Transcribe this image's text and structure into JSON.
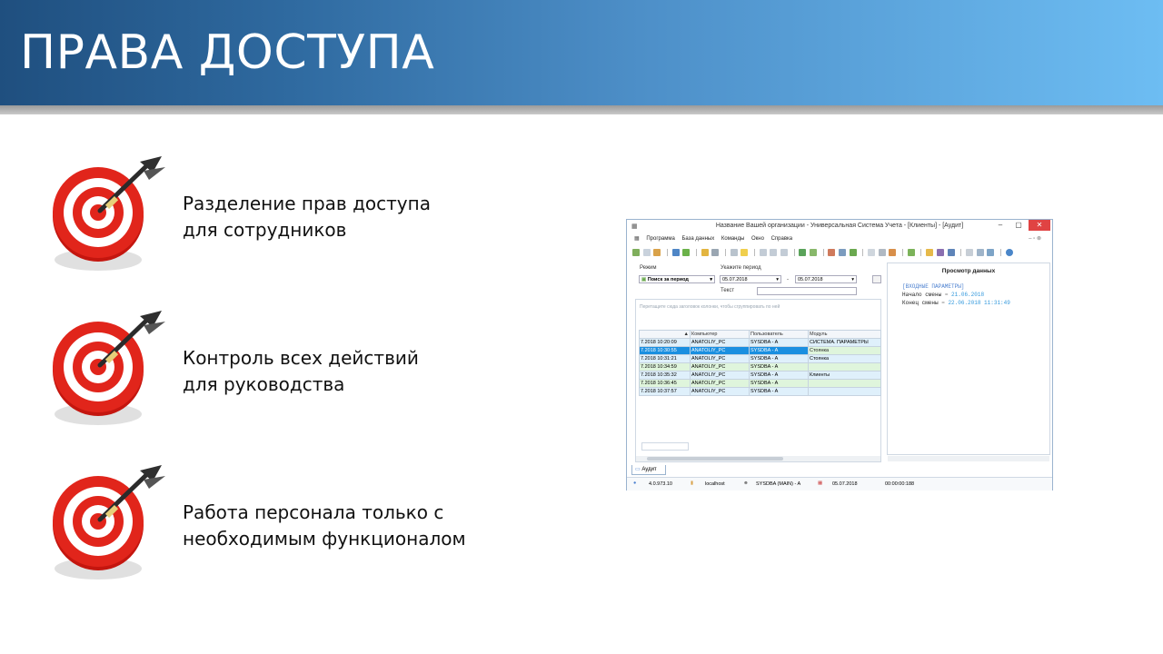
{
  "slide": {
    "title": "ПРАВА ДОСТУПА",
    "bullets": [
      {
        "line1": "Разделение прав доступа",
        "line2": "для сотрудников"
      },
      {
        "line1": "Контроль всех действий",
        "line2": "для руководства"
      },
      {
        "line1": "Работа персонала только с",
        "line2": "необходимым функционалом"
      }
    ]
  },
  "app": {
    "window_title": "Название Вашей организации - Универсальная Система Учета - [Клиенты] - [Аудит]",
    "menu": [
      "Программа",
      "База данных",
      "Команды",
      "Окно",
      "Справка"
    ],
    "filter": {
      "mode_label": "Режим",
      "mode_value": "Поиск за период",
      "period_label": "Укажите период",
      "date_from": "05.07.2018",
      "date_to": "05.07.2018",
      "dash": "-",
      "text_label": "Текст"
    },
    "group_hint": "Перетащите сюда заголовок колонки, чтобы сгруппировать по ней",
    "columns": [
      "",
      "Компьютер",
      "Пользователь",
      "Модуль"
    ],
    "rows": [
      {
        "time": "7.2018 10:20:09",
        "computer": "ANATOLIY_PC",
        "user": "SYSDBA - A",
        "module": "СИСТЕМА. ПАРАМЕТРЫ"
      },
      {
        "time": "7.2018 10:30:55",
        "computer": "ANATOLIY_PC",
        "user": "SYSDBA - A",
        "module": "Стоянка"
      },
      {
        "time": "7.2018 10:31:21",
        "computer": "ANATOLIY_PC",
        "user": "SYSDBA - A",
        "module": "Стоянка"
      },
      {
        "time": "7.2018 10:34:59",
        "computer": "ANATOLIY_PC",
        "user": "SYSDBA - A",
        "module": ""
      },
      {
        "time": "7.2018 10:35:32",
        "computer": "ANATOLIY_PC",
        "user": "SYSDBA - A",
        "module": "Клиенты"
      },
      {
        "time": "7.2018 10:36:45",
        "computer": "ANATOLIY_PC",
        "user": "SYSDBA - A",
        "module": ""
      },
      {
        "time": "7.2018 10:37:57",
        "computer": "ANATOLIY_PC",
        "user": "SYSDBA - A",
        "module": ""
      }
    ],
    "preview": {
      "title": "Просмотр данных",
      "line1": "[ВХОДНЫЕ ПАРАМЕТРЫ]",
      "line2_key": "Начало смены",
      "line2_val": "21.06.2018",
      "line3_key": "Конец смены",
      "line3_val": "22.06.2018 11:31:49",
      "eq": "="
    },
    "tab": "Аудит",
    "status": {
      "version": "4.0.973.10",
      "host": "localhost",
      "user": "SYSDBA (MAIN) - A",
      "date": "05.07.2018",
      "time": "00:00:00:188"
    }
  },
  "colors": {
    "banner_dark": "#1f4f7f",
    "banner_light": "#6dbdf3",
    "row_selected": "#1a8fe0",
    "row_green": "#dff5dc",
    "row_blue": "#dff0fb",
    "target_red": "#e1251b"
  }
}
